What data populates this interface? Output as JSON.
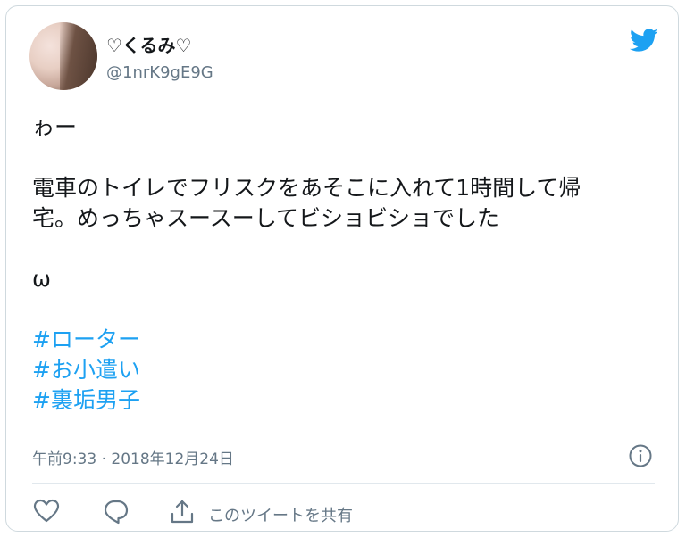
{
  "tweet": {
    "display_name": "♡くるみ♡",
    "handle": "@1nrK9gE9G",
    "lines": [
      "ゎー",
      "",
      "電車のトイレでフリスクをあそこに入れて1時間して帰",
      "宅。めっちゃスースーしてビショビショでした",
      "",
      "ω",
      ""
    ],
    "hashtags": [
      "#ローター",
      "#お小遣い",
      "#裏垢男子"
    ],
    "timestamp": "午前9:33 · 2018年12月24日"
  },
  "actions": {
    "share_label": "このツイートを共有"
  },
  "icons": {
    "logo": "twitter-bird-icon",
    "info": "info-icon",
    "like": "heart-icon",
    "reply": "reply-bubble-icon",
    "share": "share-icon"
  },
  "colors": {
    "accent": "#1da1f2",
    "secondary_text": "#657786",
    "border": "#cfd9de"
  }
}
